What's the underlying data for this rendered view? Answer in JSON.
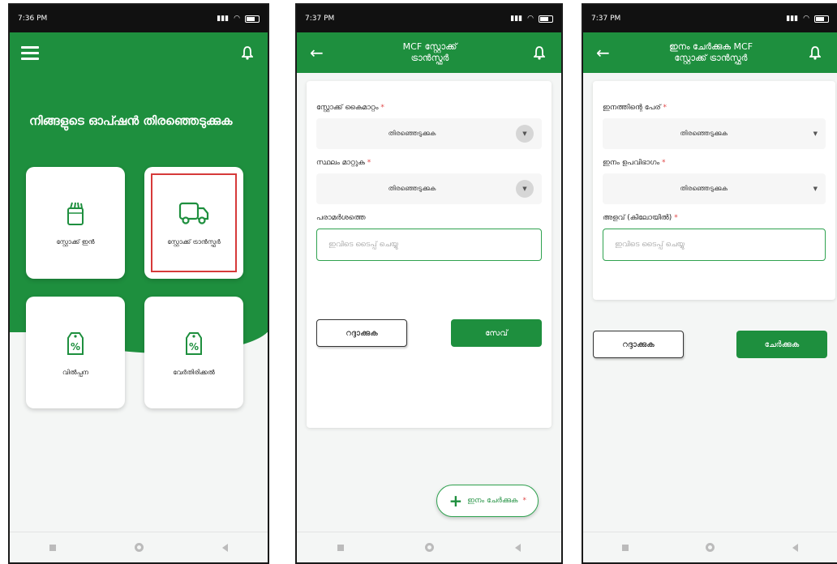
{
  "screen1": {
    "time": "7:36 PM",
    "heading": "നിങ്ങളുടെ ഓപ്ഷൻ തിരഞ്ഞെടുക്കുക",
    "tiles": [
      {
        "label": "സ്റ്റോക്ക് ഇൻ",
        "icon": "package-icon"
      },
      {
        "label": "സ്റ്റോക്ക് ട്രാൻസ്ഫർ",
        "icon": "truck-icon",
        "selected": true
      },
      {
        "label": "വിൽപ്പന",
        "icon": "percent-tag-icon"
      },
      {
        "label": "വേർതിരിക്കൽ",
        "icon": "percent-tag-icon"
      }
    ]
  },
  "screen2": {
    "time": "7:37 PM",
    "title_line1": "MCF സ്റ്റോക്ക്",
    "title_line2": "ട്രാൻസ്ഫർ",
    "field1_label": "സ്റ്റോക്ക് കൈമാറ്റം",
    "field1_value": "തിരഞ്ഞെടുക്കുക",
    "field2_label": "സ്ഥലം മാറ്റുക",
    "field2_value": "തിരഞ്ഞെടുക്കുക",
    "field3_label": "പരാമർശത്തെ",
    "field3_placeholder": "ഇവിടെ ടൈപ്പ് ചെയ്യു",
    "cancel": "റദ്ദാക്കുക",
    "save": "സേവ്",
    "fab": "ഇനം ചേർക്കുക",
    "required_mark": "*"
  },
  "screen3": {
    "time": "7:37 PM",
    "title_line1": "ഇനം ചേർക്കുക MCF",
    "title_line2": "സ്റ്റോക്ക് ട്രാൻസ്ഫർ",
    "field1_label": "ഇനത്തിന്റെ പേര്",
    "field1_value": "തിരഞ്ഞെടുക്കുക",
    "field2_label": "ഇനം ഉപവിഭാഗം",
    "field2_value": "തിരഞ്ഞെടുക്കുക",
    "field3_label": "അളവ് (കിലോയിൽ)",
    "field3_placeholder": "ഇവിടെ ടൈപ്പ് ചെയ്യു",
    "cancel": "റദ്ദാക്കുക",
    "add": "ചേർക്കുക",
    "required_mark": "*"
  },
  "colors": {
    "brand_green": "#1e8f3e",
    "highlight_red": "#d63a3a",
    "required_red": "#e04848"
  }
}
